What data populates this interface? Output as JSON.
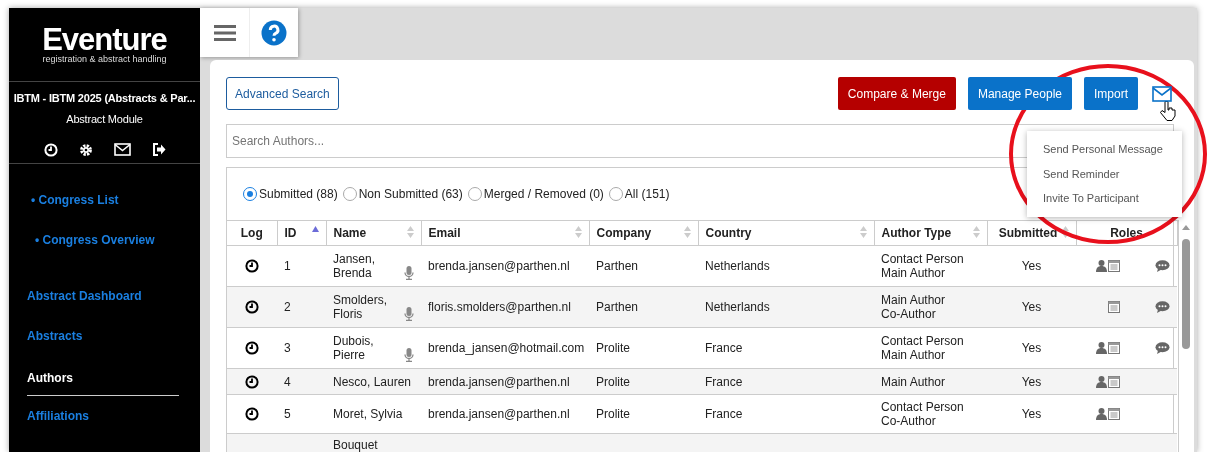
{
  "sidebar": {
    "logo": "Eventure",
    "tagline": "registration & abstract handling",
    "congress_title": "IBTM - IBTM 2025 (Abstracts & Par...",
    "module": "Abstract Module",
    "items": [
      {
        "label": "• Congress List",
        "kind": "sub",
        "selected": false
      },
      {
        "label": "• Congress Overview",
        "kind": "sub",
        "selected": false
      },
      {
        "label": "Abstract Dashboard",
        "kind": "main",
        "selected": false
      },
      {
        "label": "Abstracts",
        "kind": "main",
        "selected": false
      },
      {
        "label": "Authors",
        "kind": "main",
        "selected": true
      },
      {
        "label": "Affiliations",
        "kind": "main",
        "selected": false
      }
    ]
  },
  "toolbar": {
    "advanced_search": "Advanced Search",
    "buttons": [
      {
        "label": "Compare & Merge",
        "kind": "danger"
      },
      {
        "label": "Manage People",
        "kind": "primary"
      },
      {
        "label": "Import",
        "kind": "primary"
      }
    ]
  },
  "mail_menu": {
    "open": true,
    "items": [
      "Send Personal Message",
      "Send Reminder",
      "Invite To Participant"
    ]
  },
  "search": {
    "placeholder": "Search Authors..."
  },
  "filters": [
    {
      "label": "Submitted (88)",
      "selected": true
    },
    {
      "label": "Non Submitted (63)",
      "selected": false
    },
    {
      "label": "Merged / Removed (0)",
      "selected": false
    },
    {
      "label": "All (151)",
      "selected": false
    }
  ],
  "table": {
    "columns": [
      {
        "label": "Log",
        "sortable": false,
        "sorted": false
      },
      {
        "label": "ID",
        "sortable": true,
        "sorted": true
      },
      {
        "label": "Name",
        "sortable": true,
        "sorted": false
      },
      {
        "label": "Email",
        "sortable": true,
        "sorted": false
      },
      {
        "label": "Company",
        "sortable": true,
        "sorted": false
      },
      {
        "label": "Country",
        "sortable": true,
        "sorted": false
      },
      {
        "label": "Author Type",
        "sortable": true,
        "sorted": false
      },
      {
        "label": "Submitted",
        "sortable": true,
        "sorted": false
      },
      {
        "label": "Roles",
        "sortable": false,
        "sorted": false
      }
    ],
    "rows": [
      {
        "id": "1",
        "name": "Jansen, Brenda",
        "presenter": true,
        "email": "brenda.jansen@parthen.nl",
        "company": "Parthen",
        "country": "Netherlands",
        "author_type": [
          "Contact Person",
          "Main Author"
        ],
        "submitted": "Yes",
        "person": true,
        "form": true,
        "comment": true
      },
      {
        "id": "2",
        "name": "Smolders, Floris",
        "presenter": true,
        "email": "floris.smolders@parthen.nl",
        "company": "Parthen",
        "country": "Netherlands",
        "author_type": [
          "Main Author",
          "Co-Author"
        ],
        "submitted": "Yes",
        "person": false,
        "form": true,
        "comment": true
      },
      {
        "id": "3",
        "name": "Dubois, Pierre",
        "presenter": true,
        "email": "brenda_jansen@hotmail.com",
        "company": "Prolite",
        "country": "France",
        "author_type": [
          "Contact Person",
          "Main Author"
        ],
        "submitted": "Yes",
        "person": true,
        "form": true,
        "comment": true
      },
      {
        "id": "4",
        "name": "Nesco, Lauren",
        "presenter": false,
        "email": "brenda.jansen@parthen.nl",
        "company": "Prolite",
        "country": "France",
        "author_type": [
          "Main Author"
        ],
        "submitted": "Yes",
        "person": true,
        "form": true,
        "comment": false
      },
      {
        "id": "5",
        "name": "Moret, Sylvia",
        "presenter": false,
        "email": "brenda.jansen@parthen.nl",
        "company": "Prolite",
        "country": "France",
        "author_type": [
          "Contact Person",
          "Co-Author"
        ],
        "submitted": "Yes",
        "person": true,
        "form": true,
        "comment": false
      },
      {
        "name": "Bouquet",
        "presenter": false,
        "person": false,
        "form": false,
        "comment": false
      }
    ]
  }
}
